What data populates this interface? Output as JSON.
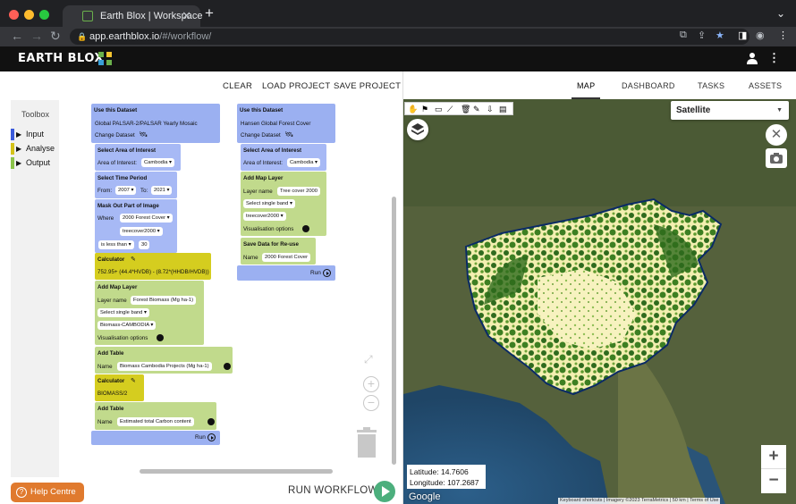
{
  "browser": {
    "tab_title": "Earth Blox | Workspace",
    "url_host": "app.earthblox.io",
    "url_path": "/#/workflow/"
  },
  "app": {
    "logo_text": "EARTH BLOX"
  },
  "toolbar": {
    "clear": "CLEAR",
    "load": "LOAD PROJECT",
    "save": "SAVE PROJECT"
  },
  "toolbox": {
    "title": "Toolbox",
    "categories": [
      {
        "label": "Input",
        "color": "#3b5bdb"
      },
      {
        "label": "Analyse",
        "color": "#d4c21a"
      },
      {
        "label": "Output",
        "color": "#8bc34a"
      }
    ]
  },
  "workflow1": {
    "dataset_title": "Use this Dataset",
    "dataset_name": "Global PALSAR-2/PALSAR Yearly Mosaic",
    "change_dataset": "Change Dataset",
    "aoi_title": "Select Area of Interest",
    "aoi_label": "Area of Interest:",
    "aoi_value": "Cambodia",
    "time_title": "Select Time Period",
    "from_label": "From:",
    "from_value": "2007",
    "to_label": "To:",
    "to_value": "2021",
    "mask_title": "Mask Out Part of Image",
    "where_label": "Where",
    "where_value": "2000 Forest Cover",
    "band_value": "treecover2000",
    "cond_value": "is less than",
    "cond_number": "30",
    "calc_title": "Calculator",
    "calc_expr": "752.95+ (44.4*HVDB) - (8.72*(HHDB/HVDB))",
    "maplayer_title": "Add Map Layer",
    "layer_name_label": "Layer name",
    "layer_name_value": "Forest Biomass (Mg ha-1)",
    "single_band": "Select single band",
    "band2_value": "Biomass-CAMBODIA",
    "vis_options": "Visualisation options",
    "table1_title": "Add Table",
    "name_label": "Name",
    "table1_name": "Biomass Cambodia Projects (Mg ha-1)",
    "calc2_title": "Calculator",
    "calc2_expr": "BIOMASS/2",
    "table2_title": "Add Table",
    "table2_name": "Estimated total Carbon content",
    "run": "Run"
  },
  "workflow2": {
    "dataset_title": "Use this Dataset",
    "dataset_name": "Hansen Global Forest Cover",
    "change_dataset": "Change Dataset",
    "aoi_title": "Select Area of Interest",
    "aoi_label": "Area of Interest:",
    "aoi_value": "Cambodia",
    "maplayer_title": "Add Map Layer",
    "layer_name_label": "Layer name",
    "layer_name_value": "Tree cover 2000",
    "single_band": "Select single band",
    "band_value": "treecover2000",
    "vis_options": "Visualisation options",
    "save_title": "Save Data for Re-use",
    "name_label": "Name",
    "save_name": "2000 Forest Cover",
    "run": "Run"
  },
  "bottom": {
    "help": "Help Centre",
    "run_workflow": "RUN WORKFLOW"
  },
  "right_tabs": {
    "map": "MAP",
    "dashboard": "DASHBOARD",
    "tasks": "TASKS",
    "assets": "ASSETS"
  },
  "map": {
    "basemap": "Satellite",
    "latitude": "Latitude: 14.7606",
    "longitude": "Longitude: 107.2687",
    "google": "Google",
    "attribution": "Keyboard shortcuts | Imagery ©2023 TerraMetrics | 50 km | Terms of Use"
  },
  "colors": {
    "accent_green": "#4caf7d",
    "help_orange": "#e07a2e",
    "block_blue": "#9bb0f1",
    "block_green": "#c1da8c",
    "block_yellow": "#d5cd1f"
  }
}
